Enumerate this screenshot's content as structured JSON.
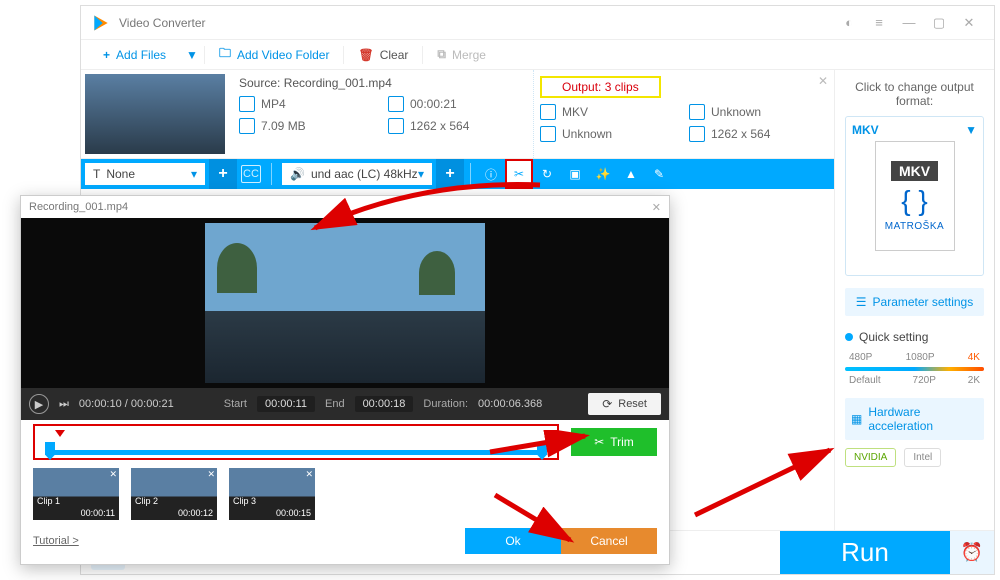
{
  "window": {
    "title": "Video Converter"
  },
  "toolbar": {
    "add_files": "Add Files",
    "add_folder": "Add Video Folder",
    "clear": "Clear",
    "merge": "Merge"
  },
  "file": {
    "source_label": "Source:",
    "source_name": "Recording_001.mp4",
    "in": {
      "format": "MP4",
      "duration": "00:00:21",
      "size": "7.09 MB",
      "resolution": "1262 x 564"
    },
    "out": {
      "output_label": "Output: 3 clips",
      "format": "MKV",
      "duration": "Unknown",
      "size": "Unknown",
      "resolution": "1262 x 564"
    }
  },
  "editbar": {
    "subtitle_value": "None",
    "audio_value": "und aac (LC) 48kHz"
  },
  "right": {
    "change_label": "Click to change output format:",
    "fmt_name": "MKV",
    "fmt_brand": "MATROŠKA",
    "param_btn": "Parameter settings",
    "quick_label": "Quick setting",
    "slider_top": [
      "480P",
      "1080P",
      "4K"
    ],
    "slider_bot": [
      "Default",
      "720P",
      "2K"
    ],
    "hw_label": "Hardware acceleration",
    "hw_nvidia": "NVIDIA",
    "hw_intel": "Intel"
  },
  "run_label": "Run",
  "trim": {
    "title": "Recording_001.mp4",
    "pos": "00:00:10",
    "total": "00:00:21",
    "start_label": "Start",
    "start_val": "00:00:11",
    "end_label": "End",
    "end_val": "00:00:18",
    "duration_label": "Duration:",
    "duration_val": "00:00:06.368",
    "reset": "Reset",
    "trim_btn": "Trim",
    "clips": [
      {
        "name": "Clip 1",
        "dur": "00:00:11"
      },
      {
        "name": "Clip 2",
        "dur": "00:00:12"
      },
      {
        "name": "Clip 3",
        "dur": "00:00:15"
      }
    ],
    "tutorial": "Tutorial >",
    "ok": "Ok",
    "cancel": "Cancel"
  }
}
